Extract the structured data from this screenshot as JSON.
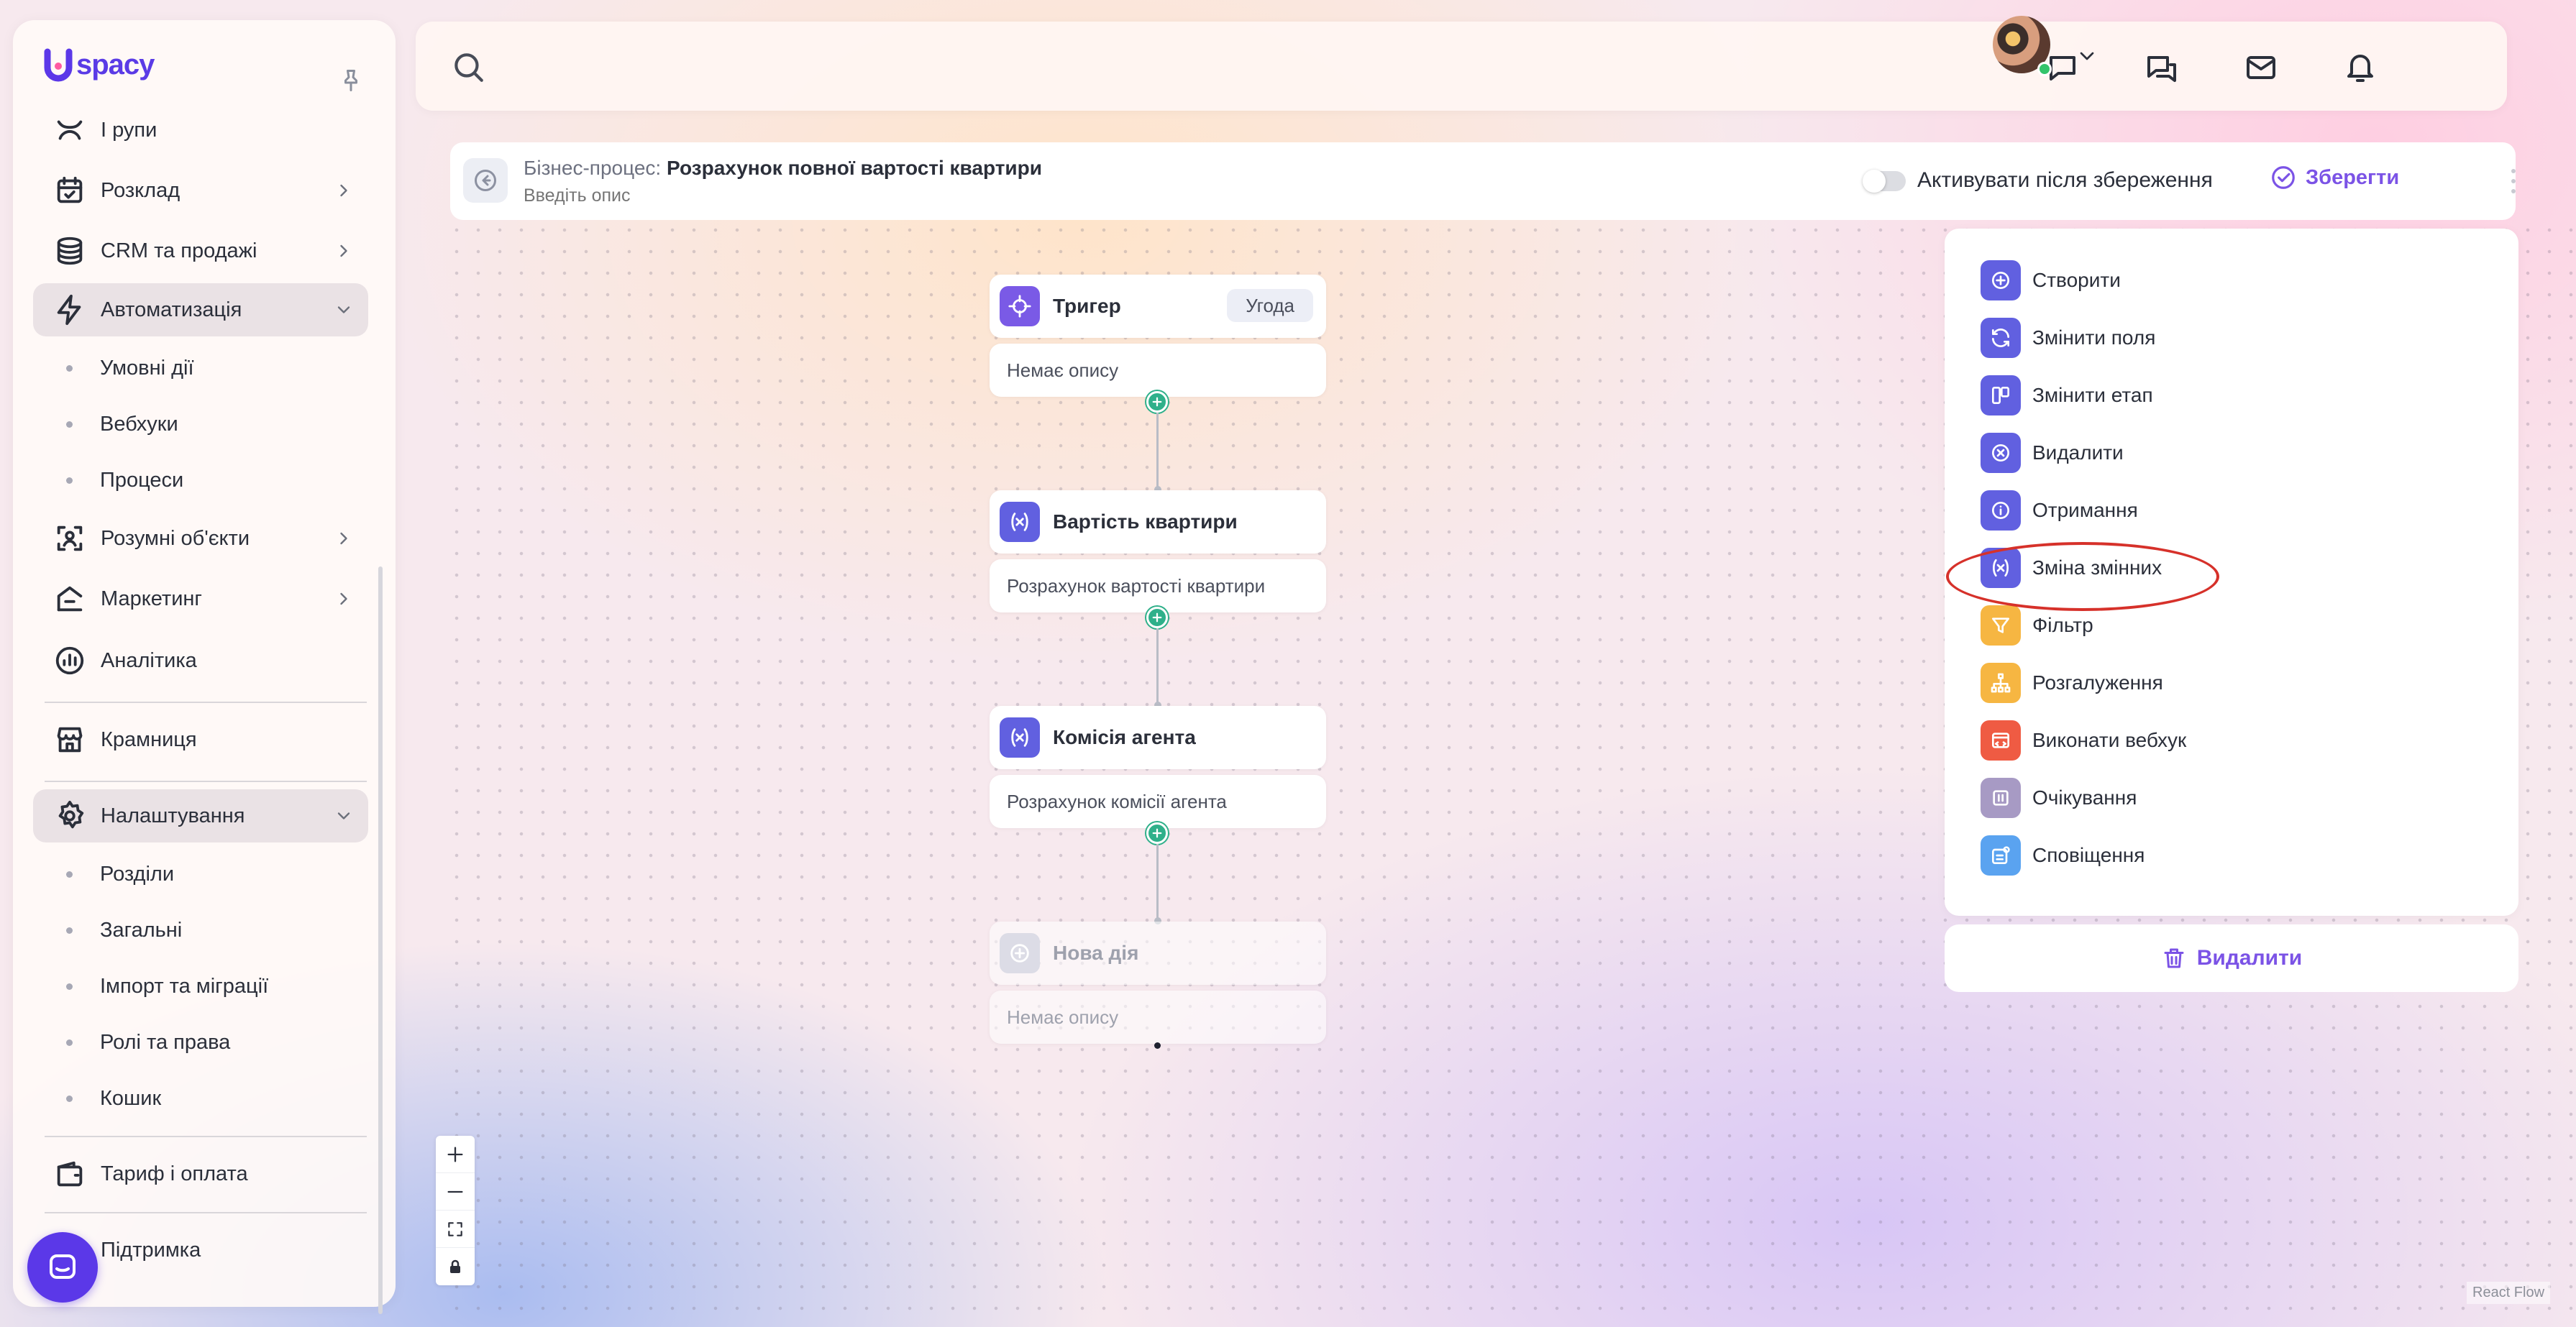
{
  "app": {
    "logo_text": "spacy"
  },
  "colors": {
    "brand": "#5b38e8",
    "accent_purple": "#7b53e6",
    "action_blue": "#6160e0",
    "action_yellow": "#f6b642",
    "action_red": "#ef5b43",
    "action_grey": "#a79ac4",
    "action_lightblue": "#5aa3f0",
    "node_purple": "#7a5ae6",
    "connector_green": "#2fb08a",
    "highlight_red": "#d6312a"
  },
  "sidebar": {
    "items": [
      {
        "label": "І рупи",
        "icon": "groups-icon"
      },
      {
        "label": "Розклад",
        "icon": "calendar-check-icon"
      },
      {
        "label": "CRM та продажі",
        "icon": "database-icon"
      },
      {
        "label": "Автоматизація",
        "icon": "lightning-icon"
      },
      {
        "label": "Розумні об'єкти",
        "icon": "scan-object-icon"
      },
      {
        "label": "Маркетинг",
        "icon": "marketing-icon"
      },
      {
        "label": "Аналітика",
        "icon": "analytics-icon"
      },
      {
        "label": "Крамниця",
        "icon": "store-icon"
      },
      {
        "label": "Налаштування",
        "icon": "gear-icon"
      },
      {
        "label": "Тариф і оплата",
        "icon": "wallet-icon"
      },
      {
        "label": "Підтримка",
        "icon": "support-icon"
      }
    ],
    "automation_sub": [
      "Умовні дії",
      "Вебхуки",
      "Процеси"
    ],
    "settings_sub": [
      "Розділи",
      "Загальні",
      "Імпорт та міграції",
      "Ролі та права",
      "Кошик"
    ]
  },
  "topbar": {
    "search_placeholder": "",
    "icons": [
      "chat-icon",
      "messages-icon",
      "mail-icon",
      "bell-icon"
    ]
  },
  "process": {
    "title_prefix": "Бізнес-процес:",
    "title": "Розрахунок повної вартості квартири",
    "description_placeholder": "Введіть опис",
    "activate_label": "Активувати після збереження",
    "activate_on": false,
    "save_label": "Зберегти"
  },
  "flow": {
    "nodes": [
      {
        "title": "Тригер",
        "tag": "Угода",
        "description": "Немає опису",
        "icon": "target-icon"
      },
      {
        "title": "Вартість квартири",
        "description": "Розрахунок вартості квартири",
        "icon": "variable-icon"
      },
      {
        "title": "Комісія агента",
        "description": "Розрахунок комісії агента",
        "icon": "variable-icon"
      },
      {
        "title": "Нова дія",
        "description": "Немає опису",
        "icon": "plus-circle-icon"
      }
    ]
  },
  "zoom_controls": [
    "zoom-in-icon",
    "zoom-out-icon",
    "fit-view-icon",
    "lock-icon"
  ],
  "react_flow_attribution": "React Flow",
  "actions": [
    {
      "label": "Створити",
      "icon": "plus-circle-icon",
      "color": "#6160e0"
    },
    {
      "label": "Змінити поля",
      "icon": "refresh-icon",
      "color": "#6160e0"
    },
    {
      "label": "Змінити етап",
      "icon": "stage-icon",
      "color": "#6160e0"
    },
    {
      "label": "Видалити",
      "icon": "x-circle-icon",
      "color": "#6160e0"
    },
    {
      "label": "Отримання",
      "icon": "info-icon",
      "color": "#6160e0"
    },
    {
      "label": "Зміна змінних",
      "icon": "variable-icon",
      "color": "#6160e0"
    },
    {
      "label": "Фільтр",
      "icon": "filter-icon",
      "color": "#f6b642"
    },
    {
      "label": "Розгалуження",
      "icon": "branch-icon",
      "color": "#f6b642"
    },
    {
      "label": "Виконати вебхук",
      "icon": "webhook-icon",
      "color": "#ef5b43"
    },
    {
      "label": "Очікування",
      "icon": "pause-icon",
      "color": "#a79ac4"
    },
    {
      "label": "Сповіщення",
      "icon": "notification-icon",
      "color": "#5aa3f0"
    }
  ],
  "delete_label": "Видалити"
}
